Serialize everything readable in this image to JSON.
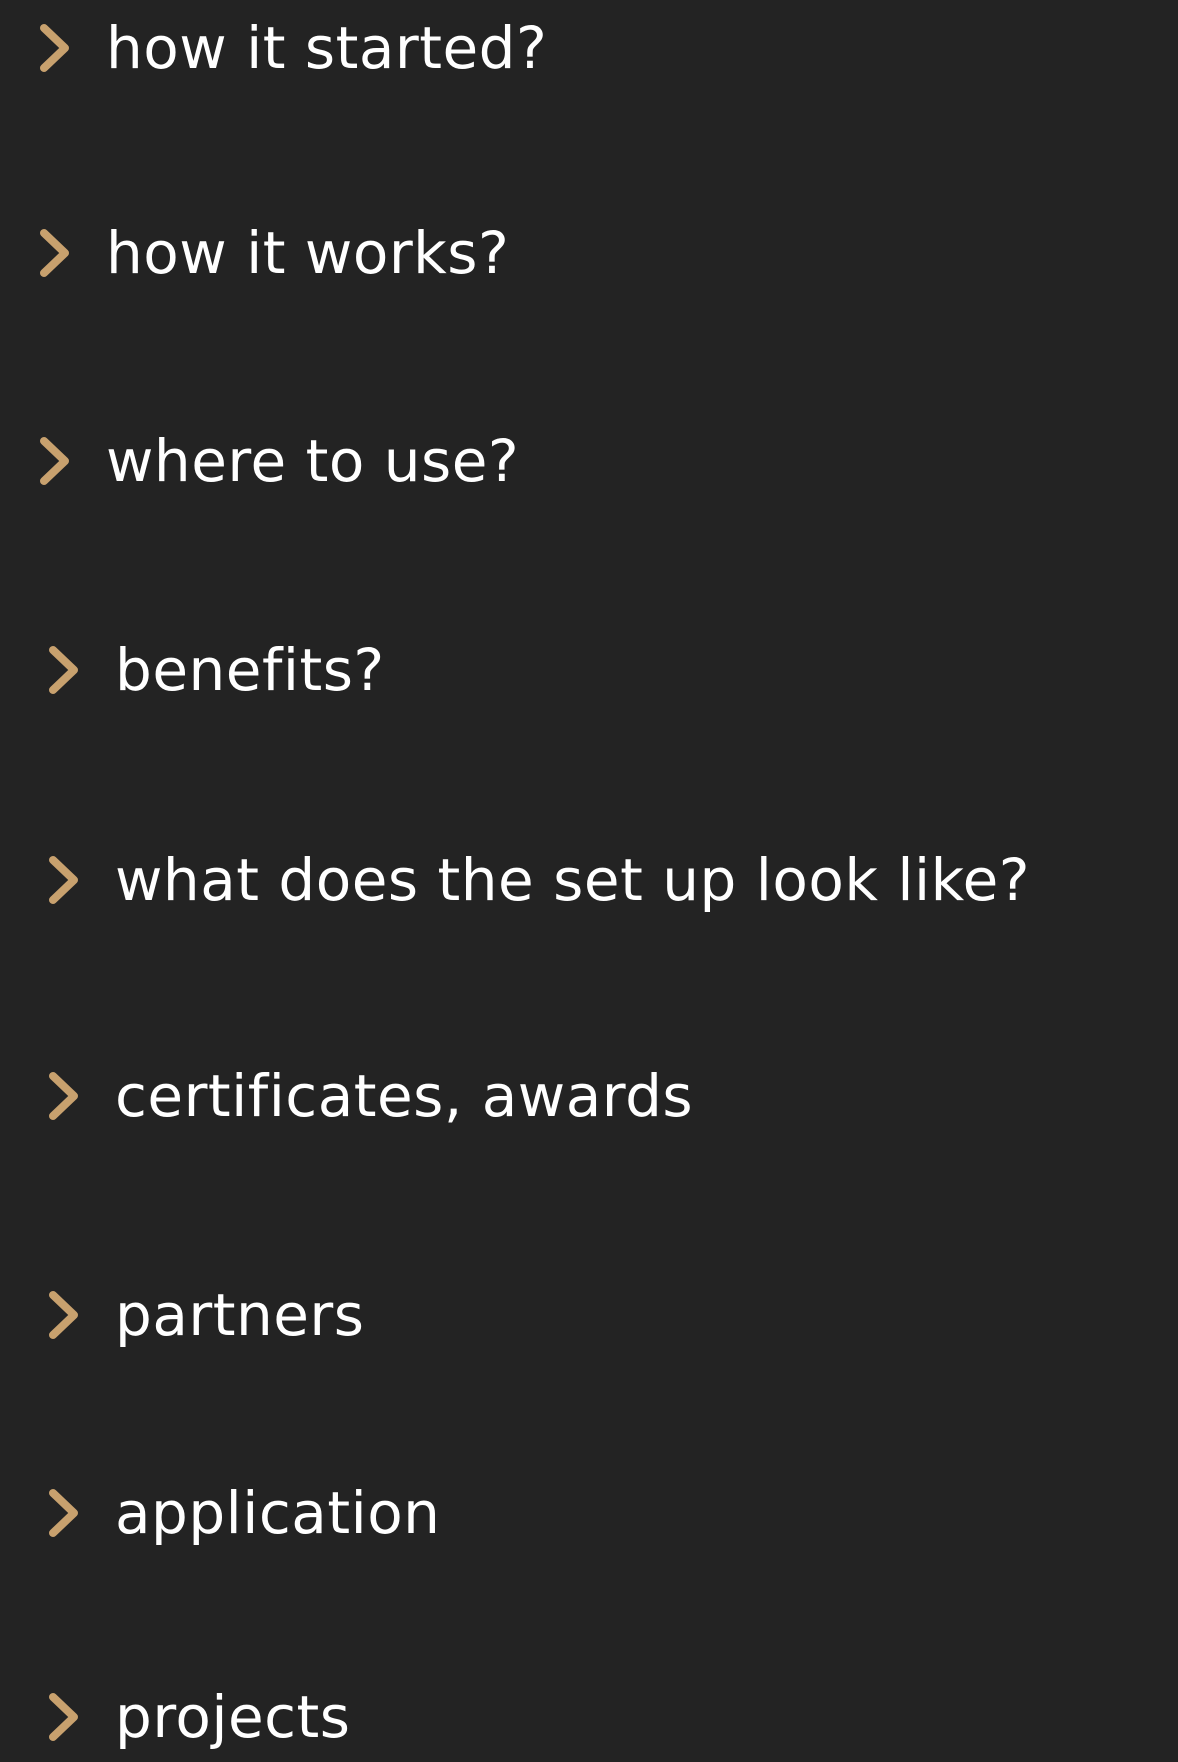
{
  "accent_color": "#C8A16E",
  "menu": {
    "items": [
      {
        "label": "how it started?",
        "icon": "chevron-right-icon"
      },
      {
        "label": "how it works?",
        "icon": "chevron-right-icon"
      },
      {
        "label": "where to use?",
        "icon": "chevron-right-icon"
      },
      {
        "label": "benefits?",
        "icon": "chevron-right-icon"
      },
      {
        "label": "what does the set up look like?",
        "icon": "chevron-right-icon"
      },
      {
        "label": "certificates, awards",
        "icon": "chevron-right-icon"
      },
      {
        "label": "partners",
        "icon": "chevron-right-icon"
      },
      {
        "label": "application",
        "icon": "chevron-right-icon"
      },
      {
        "label": "projects",
        "icon": "chevron-right-icon"
      }
    ]
  }
}
